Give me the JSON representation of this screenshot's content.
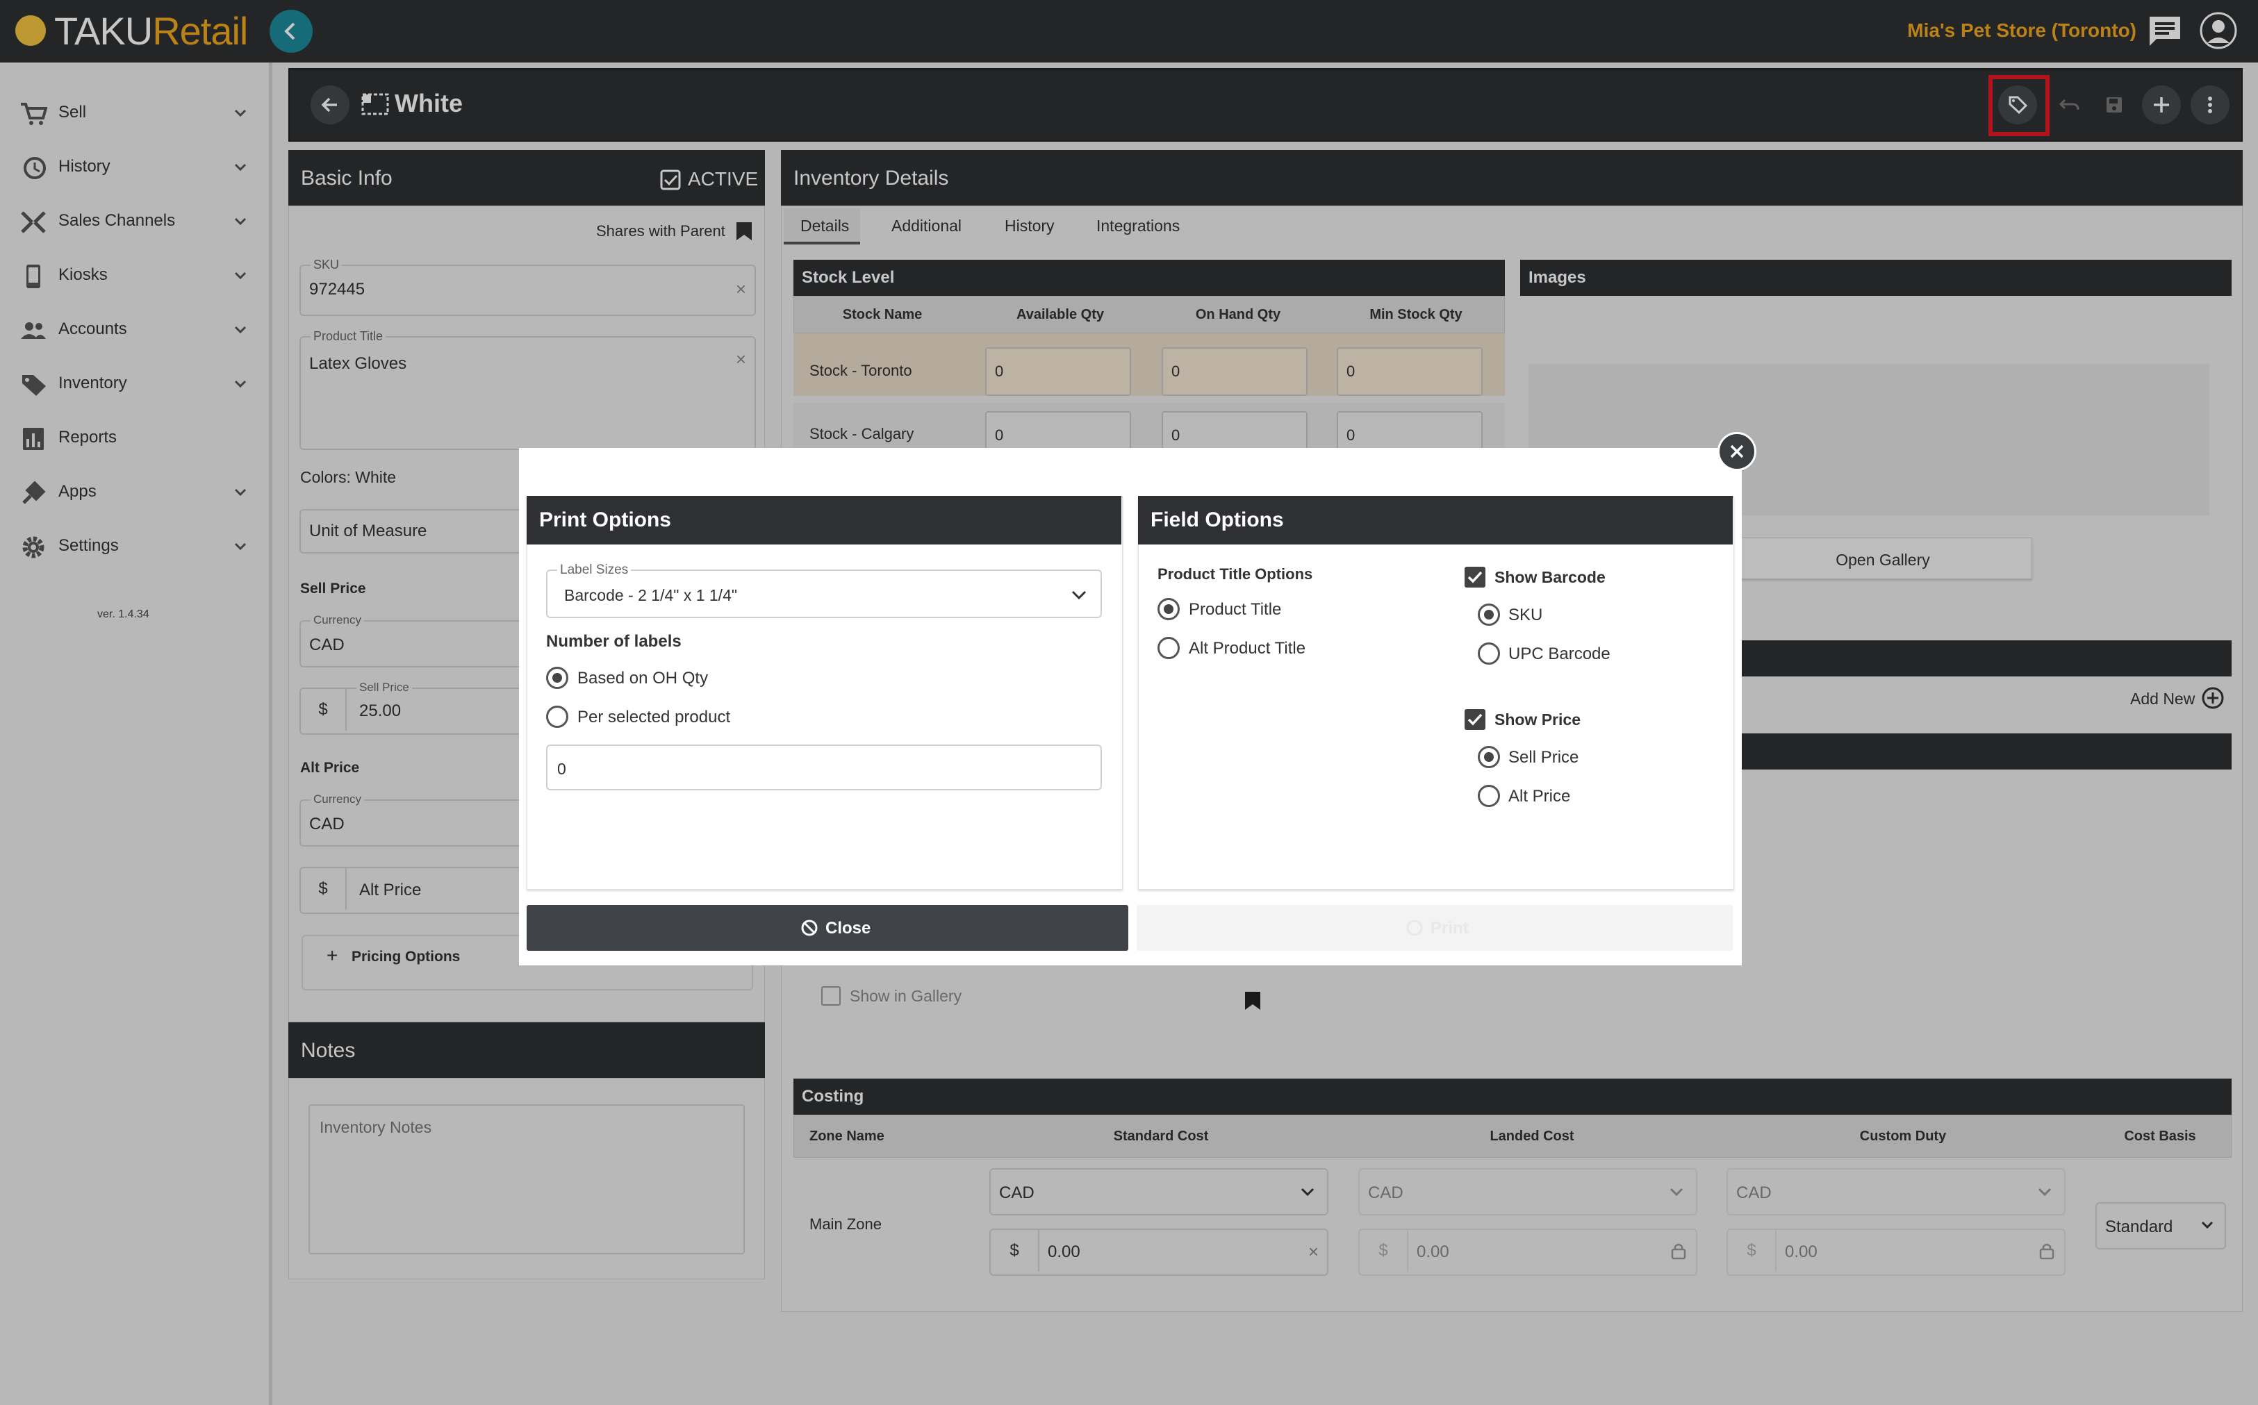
{
  "app": {
    "logo_part1": "TAKU",
    "logo_part2": "Retail",
    "store": "Mia's Pet Store (Toronto)"
  },
  "sidebar": {
    "items": [
      {
        "label": "Sell",
        "icon": "cart-icon"
      },
      {
        "label": "History",
        "icon": "history-icon"
      },
      {
        "label": "Sales Channels",
        "icon": "channels-icon"
      },
      {
        "label": "Kiosks",
        "icon": "kiosk-icon"
      },
      {
        "label": "Accounts",
        "icon": "accounts-icon"
      },
      {
        "label": "Inventory",
        "icon": "tag-icon"
      },
      {
        "label": "Reports",
        "icon": "reports-icon"
      },
      {
        "label": "Apps",
        "icon": "apps-icon"
      },
      {
        "label": "Settings",
        "icon": "gear-icon"
      }
    ],
    "version": "ver. 1.4.34"
  },
  "header": {
    "title": "White"
  },
  "basic_info": {
    "title": "Basic Info",
    "active_label": "ACTIVE",
    "shares_parent": "Shares with Parent",
    "sku_label": "SKU",
    "sku_value": "972445",
    "product_title_label": "Product Title",
    "product_title_value": "Latex Gloves",
    "colors": "Colors: White",
    "uom_placeholder": "Unit of Measure",
    "sell_price_heading": "Sell Price",
    "currency_label": "Currency",
    "currency_value": "CAD",
    "dollar": "$",
    "sell_price_label": "Sell Price",
    "sell_price_value": "25.00",
    "alt_price_heading": "Alt Price",
    "alt_currency_value": "CAD",
    "alt_price_placeholder": "Alt Price",
    "pricing_options": "Pricing Options"
  },
  "notes": {
    "title": "Notes",
    "placeholder": "Inventory Notes"
  },
  "inventory": {
    "title": "Inventory Details",
    "tabs": [
      "Details",
      "Additional",
      "History",
      "Integrations"
    ],
    "stock_level": {
      "title": "Stock Level",
      "columns": [
        "Stock Name",
        "Available Qty",
        "On Hand Qty",
        "Min Stock Qty"
      ],
      "rows": [
        {
          "name": "Stock - Toronto",
          "available": "0",
          "on_hand": "0",
          "min": "0"
        },
        {
          "name": "Stock - Calgary",
          "available": "0",
          "on_hand": "0",
          "min": "0"
        }
      ]
    },
    "images": {
      "title": "Images",
      "open_gallery": "Open Gallery"
    },
    "add_new": "Add New",
    "show_in_gallery": "Show in Gallery",
    "costing": {
      "title": "Costing",
      "columns": [
        "Zone Name",
        "Standard Cost",
        "Landed Cost",
        "Custom Duty",
        "Cost Basis"
      ],
      "zone": "Main Zone",
      "currency": "CAD",
      "dollar": "$",
      "standard_value": "0.00",
      "landed_value": "0.00",
      "duty_value": "0.00",
      "cost_basis": "Standard"
    }
  },
  "modal": {
    "print_options": {
      "title": "Print Options",
      "label_sizes_label": "Label Sizes",
      "label_size_value": "Barcode - 2 1/4\" x 1 1/4\"",
      "number_of_labels": "Number of labels",
      "option_oh_qty": "Based on OH Qty",
      "option_per_product": "Per selected product",
      "quantity_value": "0"
    },
    "field_options": {
      "title": "Field Options",
      "product_title_options": "Product Title Options",
      "product_title": "Product Title",
      "alt_product_title": "Alt Product Title",
      "show_barcode": "Show Barcode",
      "sku": "SKU",
      "upc_barcode": "UPC Barcode",
      "show_price": "Show Price",
      "sell_price": "Sell Price",
      "alt_price": "Alt Price"
    },
    "close_label": "Close",
    "print_label": "Print"
  }
}
